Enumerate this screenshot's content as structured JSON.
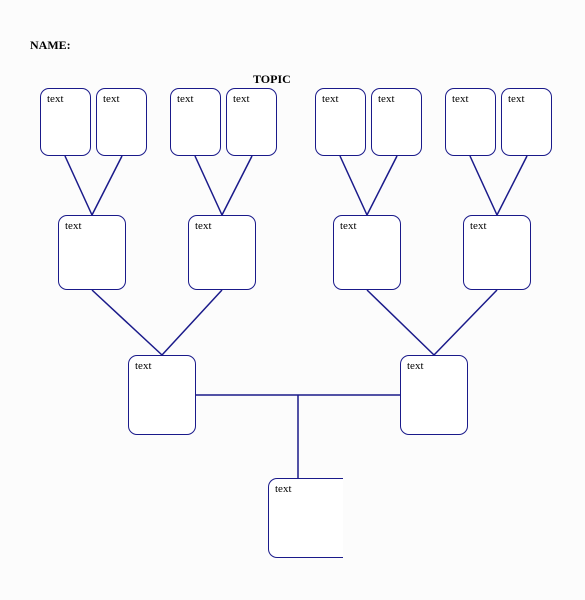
{
  "header": {
    "name_label": "NAME:",
    "topic_label": "TOPIC"
  },
  "nodes": {
    "r1c1": "text",
    "r1c2": "text",
    "r1c3": "text",
    "r1c4": "text",
    "r1c5": "text",
    "r1c6": "text",
    "r1c7": "text",
    "r1c8": "text",
    "r2c1": "text",
    "r2c2": "text",
    "r2c3": "text",
    "r2c4": "text",
    "r3c1": "text",
    "r3c2": "text",
    "r4c1": "text"
  },
  "colors": {
    "line": "#1a1a8a"
  }
}
